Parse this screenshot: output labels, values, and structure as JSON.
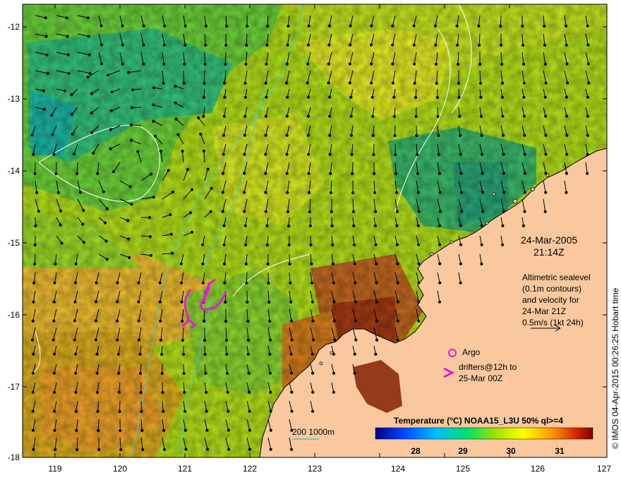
{
  "map": {
    "lat_ticks": [
      "-12",
      "-13",
      "-14",
      "-15",
      "-16",
      "-17",
      "-18"
    ],
    "lon_ticks": [
      "119",
      "120",
      "121",
      "122",
      "123",
      "124",
      "125",
      "126",
      "127"
    ],
    "date": "24-Mar-2005",
    "time": "21:14Z",
    "legend_text": [
      "Altimetric sealevel",
      "(0.1m contours)",
      "and velocity for",
      "24-Mar 21Z",
      "0.5m/s (1kt 24h)"
    ],
    "argo_label": "Argo",
    "drifters_label": [
      "drifters@12h to",
      "25-Mar 00Z"
    ],
    "colorbar_title": "Temperature (°C) NOAA15_L3U 50% ql>=4",
    "colorbar_ticks": [
      "28",
      "29",
      "30",
      "31"
    ],
    "depth_label": "200  1000m",
    "credit": "© IMOS 04-Apr-2015 00:26:25 Hobart time",
    "colors": {
      "land": "#f9c89e",
      "drifter": "#e01fd8",
      "contour_200": "#40c8c8",
      "sealevel_contour": "#ffffff"
    }
  }
}
